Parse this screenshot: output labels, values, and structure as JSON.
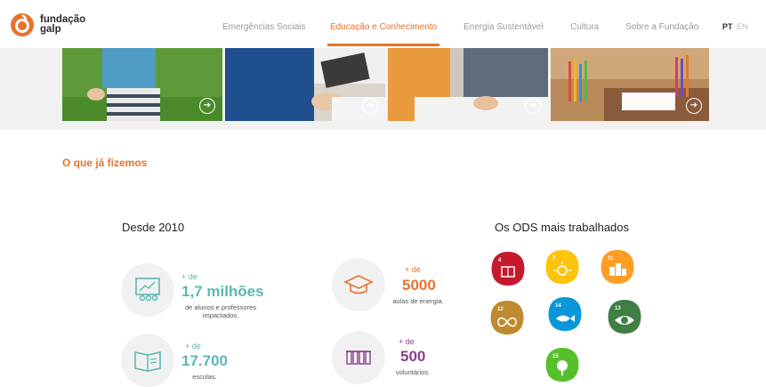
{
  "header": {
    "logo_line1": "fundação",
    "logo_line2": "galp",
    "nav": [
      {
        "label": "Emergências Sociais",
        "active": false
      },
      {
        "label": "Educação e Conhecimento",
        "active": true
      },
      {
        "label": "Energia Sustentável",
        "active": false
      },
      {
        "label": "Cultura",
        "active": false
      },
      {
        "label": "Sobre a Fundação",
        "active": false
      }
    ],
    "lang_pt": "PT",
    "lang_en": "EN"
  },
  "section_title": "O que já fizemos",
  "since": "Desde 2010",
  "stats": [
    {
      "prefix": "+ de",
      "value": "1,7 milhões",
      "desc1": "de alunos e professores",
      "desc2": "impactados."
    },
    {
      "prefix": "+ de",
      "value": "5000",
      "desc1": "aulas de energia.",
      "desc2": ""
    },
    {
      "prefix": "+ de",
      "value": "17.700",
      "desc1": "escolas.",
      "desc2": ""
    },
    {
      "prefix": "+ de",
      "value": "500",
      "desc1": "voluntários.",
      "desc2": ""
    }
  ],
  "ods_title": "Os ODS mais trabalhados",
  "ods": [
    {
      "number": "4",
      "color": "#c5192d",
      "icon": "book-icon"
    },
    {
      "number": "7",
      "color": "#fcc30b",
      "icon": "sun-icon"
    },
    {
      "number": "11",
      "color": "#fd9d24",
      "icon": "city-icon"
    },
    {
      "number": "12",
      "color": "#bf8b2e",
      "icon": "infinity-icon"
    },
    {
      "number": "14",
      "color": "#0a97d9",
      "icon": "fish-icon"
    },
    {
      "number": "13",
      "color": "#3f7e44",
      "icon": "eye-globe-icon"
    },
    {
      "number": "15",
      "color": "#56c02b",
      "icon": "tree-icon"
    }
  ],
  "colors": {
    "accent": "#e8732b",
    "teal": "#5ab8b2",
    "purple": "#8a3f8f"
  }
}
